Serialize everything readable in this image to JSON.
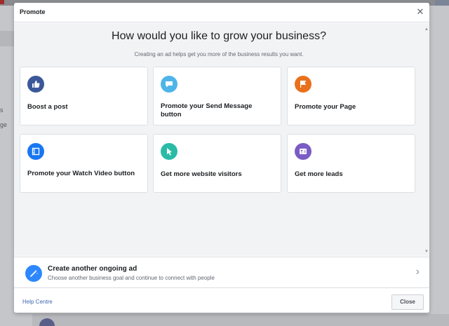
{
  "background": {
    "left_text": [
      "s",
      "ge"
    ]
  },
  "modal": {
    "title": "Promote",
    "headline": "How would you like to grow your business?",
    "subline": "Creating an ad helps get you more of the business results you want.",
    "options": [
      {
        "label": "Boost a post",
        "icon": "thumbs-up-icon",
        "color": "#3b5998"
      },
      {
        "label": "Promote your Send Message button",
        "icon": "chat-bubble-icon",
        "color": "#4fb5e8"
      },
      {
        "label": "Promote your Page",
        "icon": "flag-icon",
        "color": "#e9711c"
      },
      {
        "label": "Promote your Watch Video button",
        "icon": "video-frame-icon",
        "color": "#1877f2"
      },
      {
        "label": "Get more website visitors",
        "icon": "cursor-icon",
        "color": "#2abba7"
      },
      {
        "label": "Get more leads",
        "icon": "contact-card-icon",
        "color": "#7b5cc4"
      }
    ],
    "ongoing": {
      "title": "Create another ongoing ad",
      "description": "Choose another business goal and continue to connect with people",
      "icon": "magic-wand-icon"
    },
    "footer": {
      "help_label": "Help Centre",
      "close_label": "Close"
    }
  }
}
